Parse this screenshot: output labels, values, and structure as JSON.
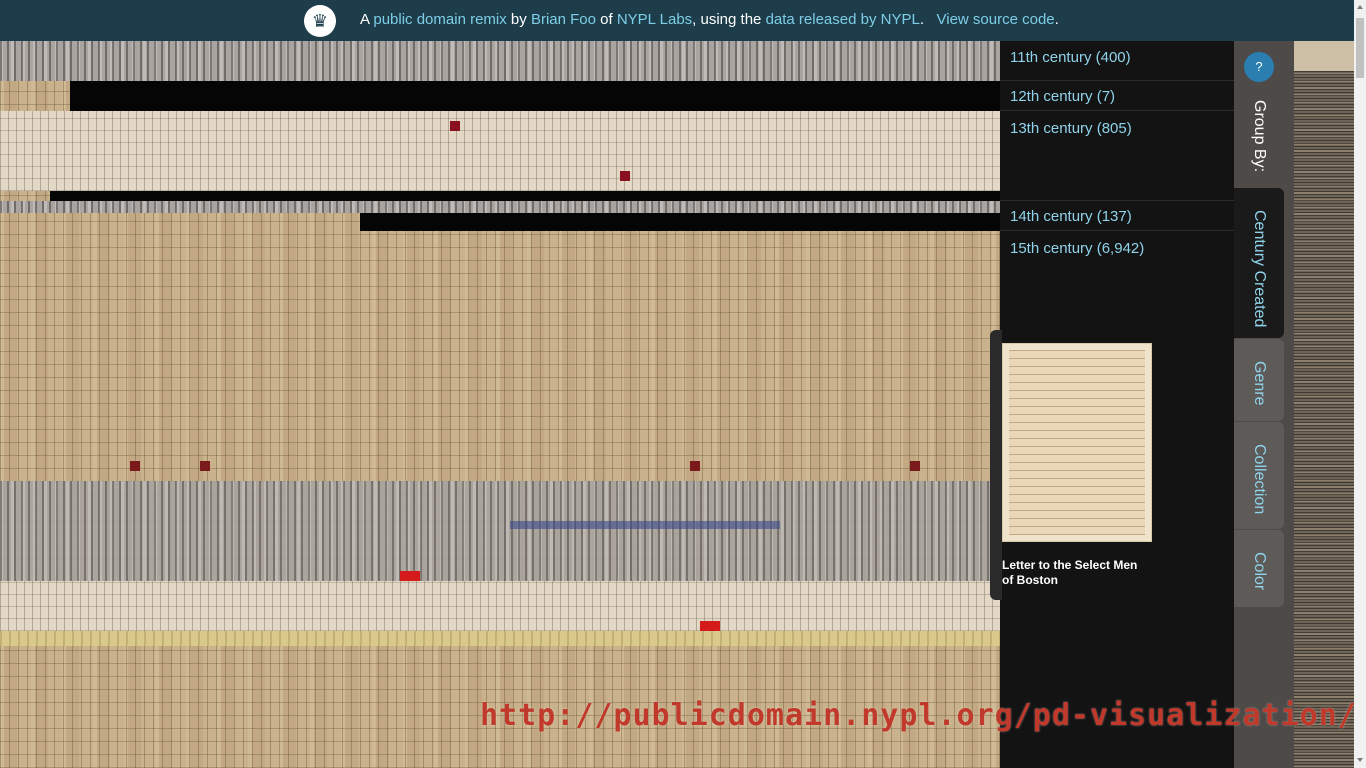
{
  "banner": {
    "prefix": "A",
    "link_remix": "public domain remix",
    "by": "by",
    "link_author": "Brian Foo",
    "of": "of",
    "link_labs": "NYPL Labs",
    "using": ", using the",
    "link_data": "data released by NYPL",
    "period": ".",
    "link_source": "View source code",
    "end": ".",
    "logo_icon": "nypl-lion-icon"
  },
  "centuries": [
    {
      "label": "11th century (400)"
    },
    {
      "label": "12th century (7)"
    },
    {
      "label": "13th century (805)"
    },
    {
      "label": "14th century (137)"
    },
    {
      "label": "15th century (6,942)"
    }
  ],
  "preview": {
    "title": "Letter to the Select Men of Boston"
  },
  "groupby": {
    "help_label": "?",
    "label": "Group By:",
    "tabs": [
      {
        "label": "Century Created",
        "active": true
      },
      {
        "label": "Genre",
        "active": false
      },
      {
        "label": "Collection",
        "active": false
      },
      {
        "label": "Color",
        "active": false
      }
    ]
  },
  "watermark": "http://publicdomain.nypl.org/pd-visualization/",
  "colors": {
    "banner_bg": "#1d3d4a",
    "link": "#7ecde6",
    "century_text": "#8fd3ea",
    "help_button": "#2a7fb0",
    "watermark": "#c0392b"
  }
}
